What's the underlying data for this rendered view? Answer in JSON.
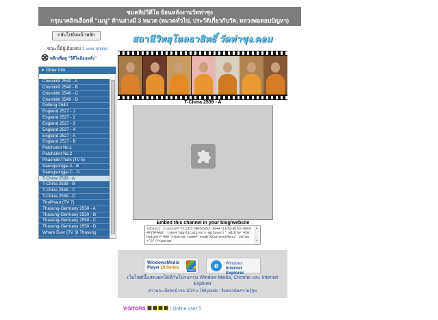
{
  "header": {
    "line1": "ชมคลิปวีดีโอ ย้อนหลังงานวัดท่าซุง",
    "line2": "กรุณาคลิกเลือกที่ \"เมนู\" ด้านล่างมี 3 หมวด (หมวดทั่วไป, ประวัติเกี่ยวกับวัด, หลวงพ่อตอบปัญหา)"
  },
  "sidebar": {
    "home_button": "กลับไปยังหน้าหลัก",
    "online_prefix": "ขณะนี้มีผู้เยี่ยมชม",
    "online_count": "1 user online",
    "ad_text": "คลิกเพื่อดู \"วีดีโอย้อนหลัง\"",
    "panel_title": "Other info",
    "items": [
      "Chomkitti 2540 - A",
      "Chomkitti 2540 - B",
      "Chomkitti 2540 - C",
      "Chomkitti 2540 - D",
      "Dollung 2540",
      "England 2527 - 1",
      "England 2527 - 2",
      "England 2527 - 3",
      "England 2527 - 4",
      "England 2527 - A",
      "England 2527 - B",
      "Patcharint No.1",
      "Patcharint No.2",
      "PhaendinTham (TV 5)",
      "Saengsongjai A - B",
      "Saengsongjai C - D",
      "T-China 2539 - A",
      "T-China 2539 - B",
      "T-China 2539 - C",
      "T-China 2539 - D",
      "ThaPhaut (TV 7)",
      "Thasung-Germany 2550 - A",
      "Thasung-Germany 2550 - B",
      "Thasung-Germany 2550 - C",
      "Thasung-Germany 2550 - D",
      "Where Ever (TV 3) Thasung"
    ],
    "selected_index": 16
  },
  "banner": {
    "logo_text": "สถานีวิทยุโหลธาสิทธิ์ วัดท่าซุง.คอม"
  },
  "player": {
    "title": "T-China 2539 - A",
    "plugin_icon": "puzzle-icon"
  },
  "embed": {
    "title": "Embed this channel in your blog/website",
    "code": "<object classid='CLSID:6BF52A52-394A-11d3-B153-00C04F79FAA6' type='application/x-mplayer2' width='450' height='400'><param name='enableContextMenu' value='0'/><param"
  },
  "browsers": {
    "wmp_line1": "WindowsMedia",
    "wmp_line2a": "Player ",
    "wmp_line2b": "10 Series",
    "wmp_free": "FREE",
    "ie_line1": "Windows",
    "ie_line2": "Internet Explorer",
    "note": "เว็บไซต์นี้แสดงผลได้ดีกับโปรแกรม Window Media, Chrome และ Internet Explorer",
    "resolution": "ความละเอียดหน้าจอ 1024 x 768 pixels : จินดลรม์ดความรู้สุข"
  },
  "footer": {
    "visitors_label": "VISITORS",
    "separator": "|",
    "online_label": "Online user 5"
  },
  "colors": {
    "header_bg": "#7d7d7d",
    "list_bg": "#2f6aa3",
    "accent": "#3572aa"
  }
}
